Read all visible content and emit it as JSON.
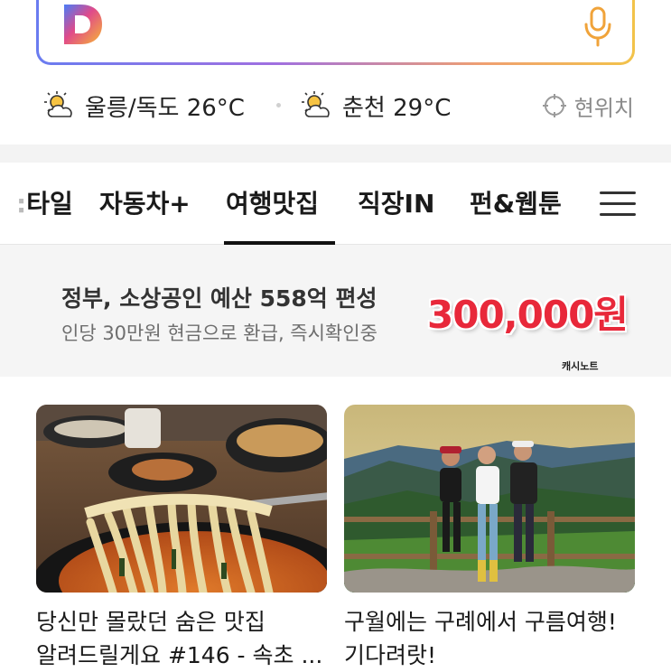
{
  "search": {
    "logo_letter": "D",
    "logo_icon": "daum-logo-icon",
    "mic_icon": "microphone-icon"
  },
  "weather": [
    {
      "icon": "partly-cloudy-sun-icon",
      "text": "울릉/독도 26°C"
    },
    {
      "icon": "partly-cloudy-sun-icon",
      "text": "춘천 29°C"
    }
  ],
  "location": {
    "icon": "crosshair-location-icon",
    "label": "현위치"
  },
  "tabs": [
    {
      "label": "스타일",
      "visible_label": "타일"
    },
    {
      "label": "자동차+"
    },
    {
      "label": "여행맛집",
      "active": true
    },
    {
      "label": "직장IN"
    },
    {
      "label": "펀&웹툰"
    }
  ],
  "menu_icon": "hamburger-menu-icon",
  "ad": {
    "title": "정부, 소상공인 예산 558억 편성",
    "subtitle": "인당 30만원 현금으로 환급, 즉시확인중",
    "amount": "300,000원",
    "brand": "캐시노트"
  },
  "cards": [
    {
      "title": "당신만 몰랐던 숨은 맛집 알려드릴게요 #146 - 속초 ...",
      "image": "noodle-photo"
    },
    {
      "title": "구월에는 구례에서 구름여행! 기다려랏!",
      "image": "mountain-hikers-photo"
    }
  ],
  "colors": {
    "accent_underline": "#111111",
    "ad_amount": "#e8283a",
    "search_gradient": [
      "#6a7cf0",
      "#a070e0",
      "#f0a070",
      "#f2c34a"
    ]
  }
}
